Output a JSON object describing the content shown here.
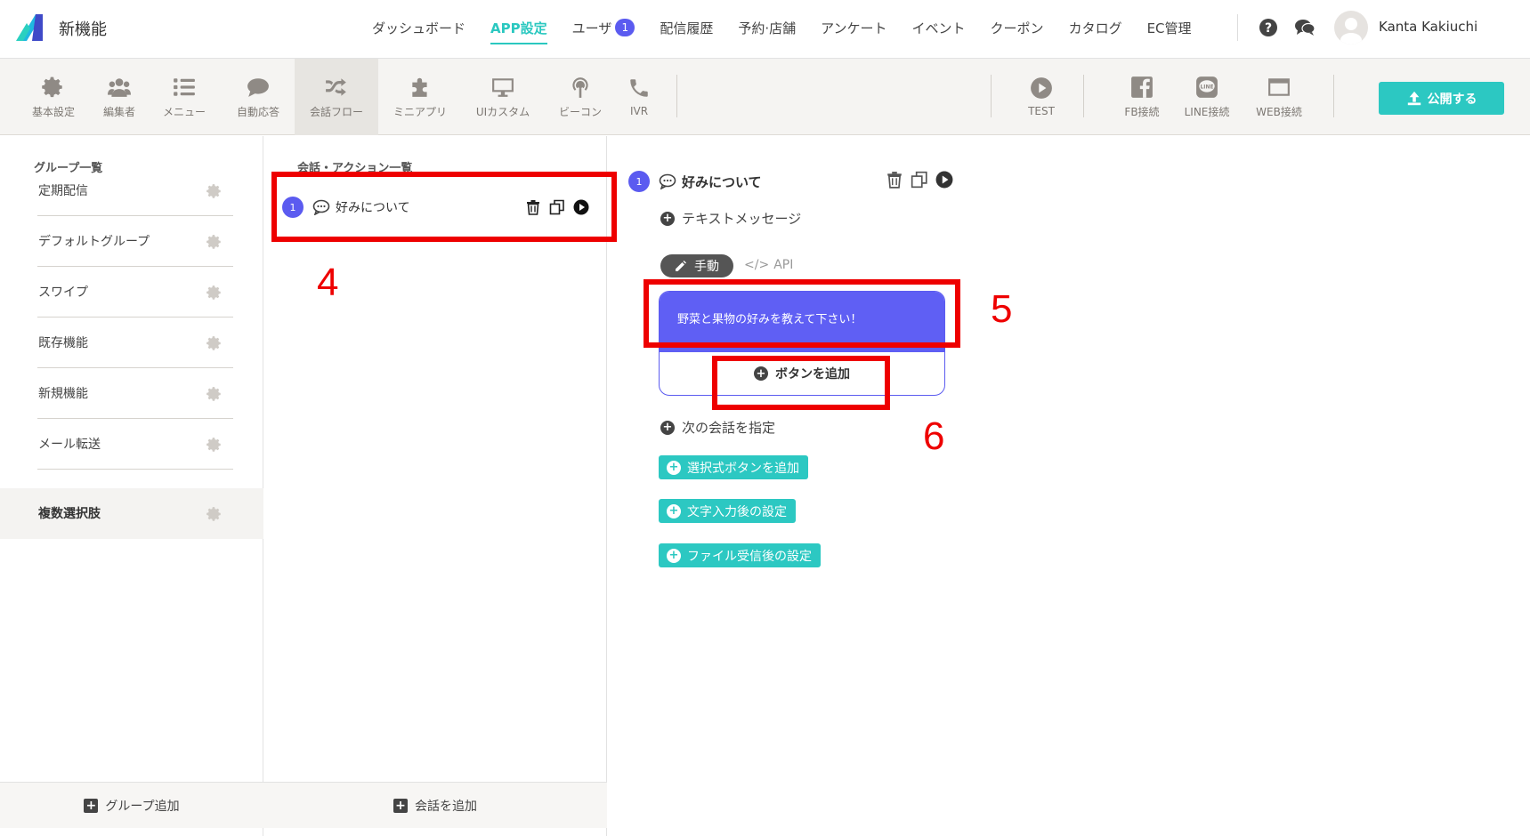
{
  "header": {
    "app_name": "新機能",
    "nav": [
      {
        "label": "ダッシュボード"
      },
      {
        "label": "APP設定",
        "active": true
      },
      {
        "label": "ユーザ",
        "badge": "1"
      },
      {
        "label": "配信履歴"
      },
      {
        "label": "予約·店舗"
      },
      {
        "label": "アンケート"
      },
      {
        "label": "イベント"
      },
      {
        "label": "クーポン"
      },
      {
        "label": "カタログ"
      },
      {
        "label": "EC管理"
      }
    ],
    "user_name": "Kanta Kakiuchi"
  },
  "toolbar": {
    "items": [
      {
        "label": "基本設定",
        "icon": "gear-icon"
      },
      {
        "label": "編集者",
        "icon": "users-icon"
      },
      {
        "label": "メニュー",
        "icon": "list-icon"
      },
      {
        "label": "自動応答",
        "icon": "chat-icon"
      },
      {
        "label": "会話フロー",
        "icon": "shuffle-icon",
        "active": true
      },
      {
        "label": "ミニアプリ",
        "icon": "puzzle-icon"
      },
      {
        "label": "UIカスタム",
        "icon": "monitor-icon"
      },
      {
        "label": "ビーコン",
        "icon": "beacon-icon"
      },
      {
        "label": "IVR",
        "icon": "phone-icon"
      }
    ],
    "right_items": [
      {
        "label": "TEST",
        "icon": "play-icon"
      },
      {
        "label": "FB接続",
        "icon": "facebook-icon"
      },
      {
        "label": "LINE接続",
        "icon": "line-icon"
      },
      {
        "label": "WEB接続",
        "icon": "browser-icon"
      }
    ],
    "publish_label": "公開する"
  },
  "groups": {
    "title": "グループ一覧",
    "items": [
      {
        "label": "定期配信"
      },
      {
        "label": "デフォルトグループ"
      },
      {
        "label": "スワイプ"
      },
      {
        "label": "既存機能"
      },
      {
        "label": "新規機能"
      },
      {
        "label": "メール転送"
      },
      {
        "label": "複数選択肢",
        "active": true
      }
    ],
    "add_label": "グループ追加"
  },
  "conversations": {
    "title": "会話・アクション一覧",
    "items": [
      {
        "number": "1",
        "label": "好みについて"
      }
    ],
    "add_label": "会話を追加"
  },
  "editor": {
    "number": "1",
    "title": "好みについて",
    "text_message_label": "テキストメッセージ",
    "mode_manual": "手動",
    "mode_api": "API",
    "message_text": "野菜と果物の好みを教えて下さい！",
    "add_button_label": "ボタンを追加",
    "next_conversation_label": "次の会話を指定",
    "buttons": [
      {
        "label": "選択式ボタンを追加"
      },
      {
        "label": "文字入力後の設定"
      },
      {
        "label": "ファイル受信後の設定"
      }
    ]
  },
  "annotations": [
    "4",
    "5",
    "6"
  ],
  "colors": {
    "accent_teal": "#2cc8c2",
    "accent_purple": "#5f5ff4",
    "annotation_red": "#ee0000"
  }
}
